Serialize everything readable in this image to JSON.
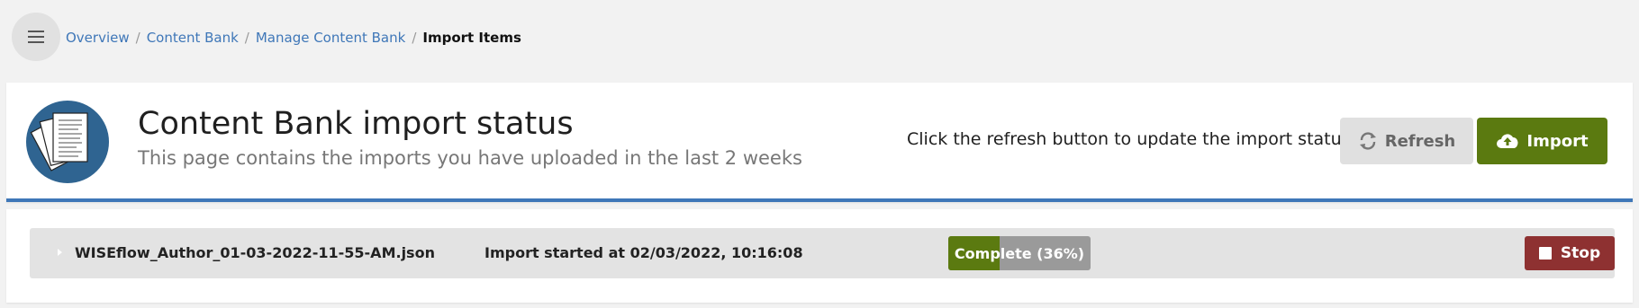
{
  "breadcrumb": {
    "items": [
      "Overview",
      "Content Bank",
      "Manage Content Bank"
    ],
    "current": "Import Items",
    "separator": "/"
  },
  "header": {
    "title": "Content Bank import status",
    "subtitle": "This page contains the imports you have uploaded in the last 2 weeks",
    "hint": "Click the refresh button to update the import status",
    "refresh_label": "Refresh",
    "import_label": "Import"
  },
  "imports": [
    {
      "filename": "WISEflow_Author_01-03-2022-11-55-AM.json",
      "started": "Import started at 02/03/2022, 10:16:08",
      "status_label": "Complete (36%)",
      "progress_percent": 36,
      "stop_label": "Stop"
    }
  ],
  "icons": {
    "menu": "hamburger-menu-icon",
    "logo": "documents-logo",
    "refresh": "sync-arrows-icon",
    "import": "cloud-upload-icon",
    "expand": "caret-right-icon",
    "stop": "stop-square-icon"
  },
  "colors": {
    "link": "#3f77b8",
    "accent_border": "#3f77b8",
    "import_button": "#5b7a10",
    "progress_fill": "#5b7a10",
    "stop_button": "#8e3131",
    "refresh_button": "#e0e0e0"
  }
}
